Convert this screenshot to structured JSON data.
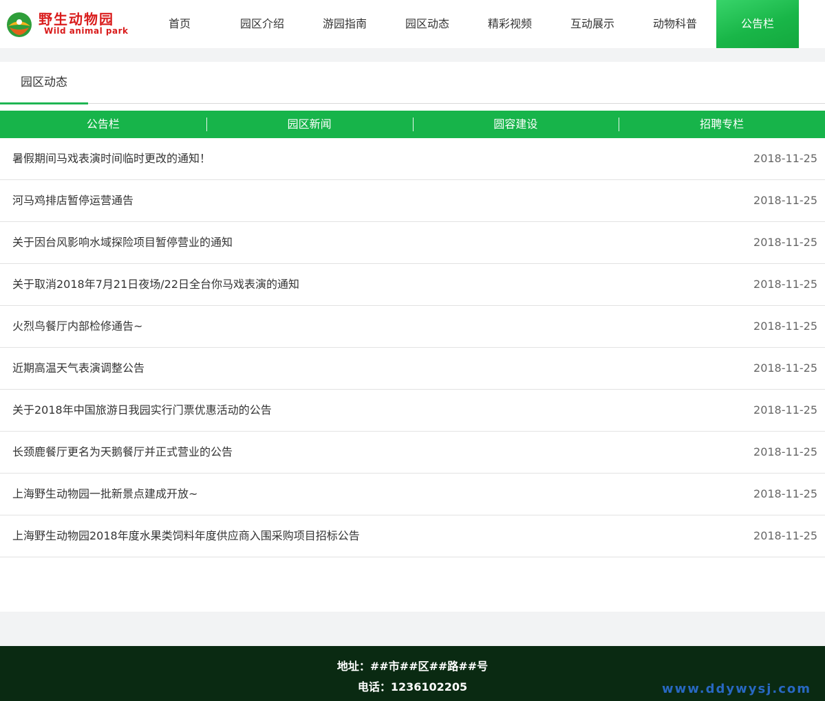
{
  "colors": {
    "brand_green": "#17b44a",
    "logo_red": "#d91b1b",
    "footer_bg": "#0a2a12",
    "watermark_blue": "#2c6fd6"
  },
  "logo": {
    "title_cn": "野生动物园",
    "title_en": "Wild animal park",
    "icon": "park-emblem-icon"
  },
  "nav": {
    "items": [
      {
        "label": "首页"
      },
      {
        "label": "园区介绍"
      },
      {
        "label": "游园指南"
      },
      {
        "label": "园区动态"
      },
      {
        "label": "精彩视频"
      },
      {
        "label": "互动展示"
      },
      {
        "label": "动物科普"
      },
      {
        "label": "公告栏"
      }
    ],
    "active": "公告栏"
  },
  "section": {
    "title": "园区动态"
  },
  "tabs": [
    {
      "label": "公告栏"
    },
    {
      "label": "园区新闻"
    },
    {
      "label": "圆容建设"
    },
    {
      "label": "招聘专栏"
    }
  ],
  "notices": [
    {
      "title": "暑假期间马戏表演时间临时更改的通知！",
      "date": "2018-11-25"
    },
    {
      "title": "河马鸡排店暂停运营通告",
      "date": "2018-11-25"
    },
    {
      "title": "关于因台风影响水域探险项目暂停营业的通知",
      "date": "2018-11-25"
    },
    {
      "title": "关于取消2018年7月21日夜场/22日全台你马戏表演的通知",
      "date": "2018-11-25"
    },
    {
      "title": "火烈鸟餐厅内部检修通告~",
      "date": "2018-11-25"
    },
    {
      "title": "近期高温天气表演调整公告",
      "date": "2018-11-25"
    },
    {
      "title": "关于2018年中国旅游日我园实行门票优惠活动的公告",
      "date": "2018-11-25"
    },
    {
      "title": "长颈鹿餐厅更名为天鹅餐厅并正式营业的公告",
      "date": "2018-11-25"
    },
    {
      "title": "上海野生动物园一批新景点建成开放~",
      "date": "2018-11-25"
    },
    {
      "title": "上海野生动物园2018年度水果类饲料年度供应商入围采购项目招标公告",
      "date": "2018-11-25"
    }
  ],
  "footer": {
    "address": "地址：##市##区##路##号",
    "phone": "电话：1236102205",
    "watermark": "www.ddywysj.com"
  }
}
